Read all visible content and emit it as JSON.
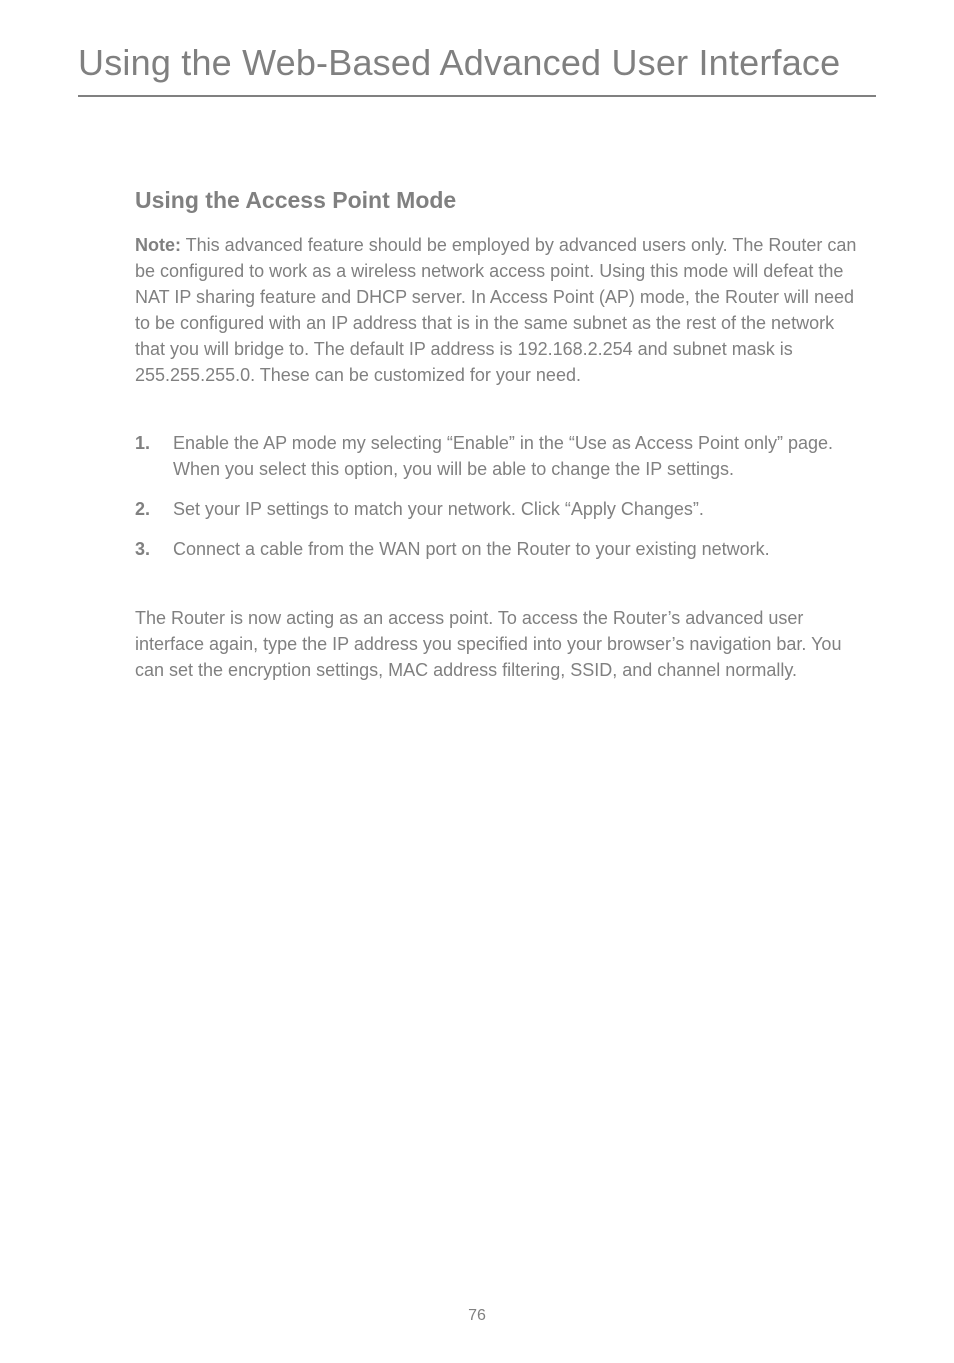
{
  "chapter_title": "Using the Web-Based Advanced User Interface",
  "section_title": "Using the Access Point Mode",
  "note_label": "Note:",
  "note_body": " This advanced feature should be employed by advanced users only. The Router can be configured to work as a wireless network access point. Using this mode will defeat the NAT IP sharing feature and DHCP server. In Access Point (AP) mode, the Router will need to be configured with an IP address that is in the same subnet as the rest of the network that you will bridge to. The default IP address is 192.168.2.254 and subnet mask is 255.255.255.0. These can be customized for your need.",
  "steps": [
    {
      "num": "1.",
      "text": "Enable the AP mode my selecting “Enable” in the “Use as Access Point only” page. When you select this option, you will be able to change the IP settings."
    },
    {
      "num": "2.",
      "text": "Set your IP settings to match your network. Click “Apply Changes”."
    },
    {
      "num": "3.",
      "text": "Connect a cable from the WAN port on the Router to your existing network."
    }
  ],
  "closing_text": "The Router is now acting as an access point. To access the Router’s advanced user interface again, type the IP address you specified into your browser’s navigation bar. You can set the encryption settings, MAC address filtering, SSID, and channel normally.",
  "page_number": "76"
}
